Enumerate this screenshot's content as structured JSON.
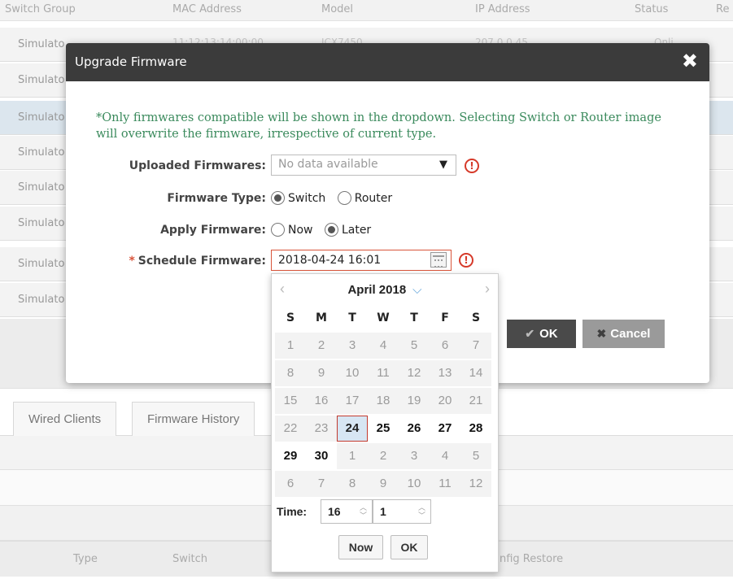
{
  "background": {
    "table_headers": [
      "Switch Group",
      "MAC Address",
      "Model",
      "IP Address",
      "Status",
      "Re"
    ],
    "row_label": "Simulato",
    "ghost_row": [
      "11:12:13:14:00:00",
      "ICX7450",
      "207.0.0.45",
      "Onli"
    ],
    "tabs": [
      "Wired Clients",
      "Firmware History"
    ],
    "bottom_headers": [
      "Type",
      "Switch",
      "nfig Restore"
    ]
  },
  "modal": {
    "title": "Upgrade Firmware",
    "close": "✖",
    "note": "*Only firmwares compatible will be shown in the dropdown. Selecting Switch or Router image will overwrite the firmware, irrespective of current type.",
    "uploaded_firmwares": {
      "label": "Uploaded Firmwares:",
      "placeholder": "No data available",
      "warn": "!"
    },
    "firmware_type": {
      "label": "Firmware Type:",
      "options": [
        "Switch",
        "Router"
      ],
      "selected": "Switch"
    },
    "apply_firmware": {
      "label": "Apply Firmware:",
      "options": [
        "Now",
        "Later"
      ],
      "selected": "Later"
    },
    "schedule_firmware": {
      "required_mark": "*",
      "label": "Schedule Firmware:",
      "value": "2018-04-24 16:01",
      "warn": "!"
    },
    "ok_label": "OK",
    "cancel_label": "Cancel"
  },
  "date_picker": {
    "month_title": "April 2018",
    "prev": "‹",
    "next": "›",
    "dropdown": "⌵",
    "weekdays": [
      "S",
      "M",
      "T",
      "W",
      "T",
      "F",
      "S"
    ],
    "weeks": [
      [
        "1",
        "2",
        "3",
        "4",
        "5",
        "6",
        "7"
      ],
      [
        "8",
        "9",
        "10",
        "11",
        "12",
        "13",
        "14"
      ],
      [
        "15",
        "16",
        "17",
        "18",
        "19",
        "20",
        "21"
      ],
      [
        "22",
        "23",
        "24",
        "25",
        "26",
        "27",
        "28"
      ],
      [
        "29",
        "30",
        "1",
        "2",
        "3",
        "4",
        "5"
      ],
      [
        "6",
        "7",
        "8",
        "9",
        "10",
        "11",
        "12"
      ]
    ],
    "selected": "24",
    "time_label": "Time:",
    "hour": "16",
    "minute": "1",
    "now_label": "Now",
    "ok_label": "OK"
  }
}
